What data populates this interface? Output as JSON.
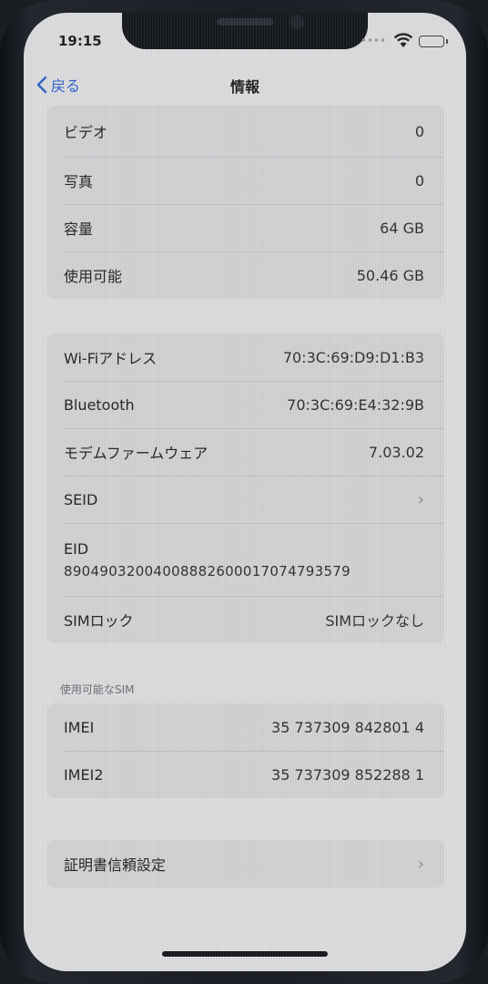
{
  "status_bar": {
    "time": "19:15"
  },
  "navbar": {
    "back_label": "戻る",
    "title": "情報"
  },
  "storage_group": [
    {
      "label": "ビデオ",
      "value": "0"
    },
    {
      "label": "写真",
      "value": "0"
    },
    {
      "label": "容量",
      "value": "64 GB"
    },
    {
      "label": "使用可能",
      "value": "50.46 GB"
    }
  ],
  "network_group": {
    "wifi": {
      "label": "Wi-Fiアドレス",
      "value": "70:3C:69:D9:D1:B3"
    },
    "bluetooth": {
      "label": "Bluetooth",
      "value": "70:3C:69:E4:32:9B"
    },
    "modem": {
      "label": "モデムファームウェア",
      "value": "7.03.02"
    },
    "seid": {
      "label": "SEID"
    },
    "eid": {
      "label": "EID",
      "value": "89049032004008882600017074793579"
    },
    "sim_lock": {
      "label": "SIMロック",
      "value": "SIMロックなし"
    }
  },
  "sim_section": {
    "header": "使用可能なSIM",
    "rows": [
      {
        "label": "IMEI",
        "value": "35 737309 842801 4"
      },
      {
        "label": "IMEI2",
        "value": "35 737309 852288 1"
      }
    ]
  },
  "certificate": {
    "label": "証明書信頼設定"
  },
  "colors": {
    "accent": "#2c63c9",
    "background": "#dcdcdf",
    "cell": "#d2d2d5"
  }
}
